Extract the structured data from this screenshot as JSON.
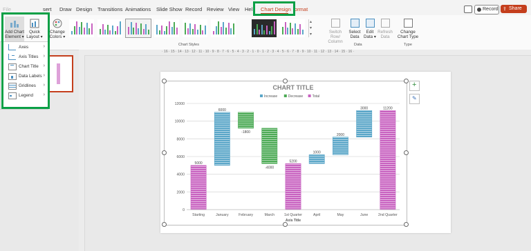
{
  "tabs": {
    "partial": "File",
    "insert_partial": "sert",
    "draw": "Draw",
    "design": "Design",
    "transitions": "Transitions",
    "animations": "Animations",
    "slide_show": "Slide Show",
    "record": "Record",
    "review": "Review",
    "view": "View",
    "help_partial": "Hel",
    "chart_design": "Chart Design",
    "format_partial": "ormat"
  },
  "top_right": {
    "record_label": "Record",
    "share_label": "Share"
  },
  "ribbon": {
    "add_chart_element": [
      "Add Chart",
      "Element ▾"
    ],
    "quick_layout": [
      "Quick",
      "Layout ▾"
    ],
    "change_colors": [
      "Change",
      "Colors ▾"
    ],
    "chart_styles_label": "Chart Styles",
    "switch_row_column": [
      "Switch Row/",
      "Column"
    ],
    "select_data": [
      "Select",
      "Data"
    ],
    "edit_data": [
      "Edit",
      "Data ▾"
    ],
    "refresh_data": [
      "Refresh",
      "Data"
    ],
    "data_group_label": "Data",
    "change_chart_type": [
      "Change",
      "Chart Type"
    ],
    "type_group_label": "Type"
  },
  "add_element_menu": [
    {
      "label": "Axes",
      "icon": "axes-icon"
    },
    {
      "label": "Axis Titles",
      "icon": "axis-titles-icon"
    },
    {
      "label": "Chart Title",
      "icon": "chart-title-icon"
    },
    {
      "label": "Data Labels",
      "icon": "data-labels-icon"
    },
    {
      "label": "Gridlines",
      "icon": "gridlines-icon"
    },
    {
      "label": "Legend",
      "icon": "legend-icon"
    }
  ],
  "ruler_numbers": "· 16 · 15 · 14 · 13 · 12 · 11 · 10 · 9 · 8 · 7 · 6 · 5 · 4 · 3 · 2 · 1 · 0 · 1 · 2 · 3 · 4 · 5 · 6 · 7 · 8 · 9 · 10 · 11 · 12 · 13 · 14 · 15 · 16 ·",
  "colors": {
    "increase": "#5aa6c8",
    "decrease": "#4caa55",
    "total": "#c862c0",
    "accent_red": "#c43e1c",
    "highlight_green": "#0aa046"
  },
  "chart_data": {
    "type": "bar",
    "subtype": "waterfall",
    "title": "CHART TITLE",
    "xlabel": "Axis Title",
    "ylabel": "",
    "ylim": [
      0,
      12000
    ],
    "yticks": [
      0,
      2000,
      4000,
      6000,
      8000,
      10000,
      12000
    ],
    "legend": [
      "Increase",
      "Decrease",
      "Total"
    ],
    "legend_position": "top",
    "grid": true,
    "categories": [
      "Starting",
      "January",
      "February",
      "March",
      "1st Quarter",
      "April",
      "May",
      "June",
      "2nd Quarter"
    ],
    "bars": [
      {
        "kind": "total",
        "base": 0,
        "top": 5000,
        "label": "5000"
      },
      {
        "kind": "increase",
        "base": 5000,
        "top": 11000,
        "label": "6000"
      },
      {
        "kind": "decrease",
        "base": 9200,
        "top": 11000,
        "label": "-1800"
      },
      {
        "kind": "decrease",
        "base": 5200,
        "top": 9200,
        "label": "-4000"
      },
      {
        "kind": "total",
        "base": 0,
        "top": 5200,
        "label": "5200"
      },
      {
        "kind": "increase",
        "base": 5200,
        "top": 6200,
        "label": "1000"
      },
      {
        "kind": "increase",
        "base": 6200,
        "top": 8200,
        "label": "2000"
      },
      {
        "kind": "increase",
        "base": 8200,
        "top": 11200,
        "label": "3000"
      },
      {
        "kind": "total",
        "base": 0,
        "top": 11200,
        "label": "11200"
      }
    ]
  }
}
